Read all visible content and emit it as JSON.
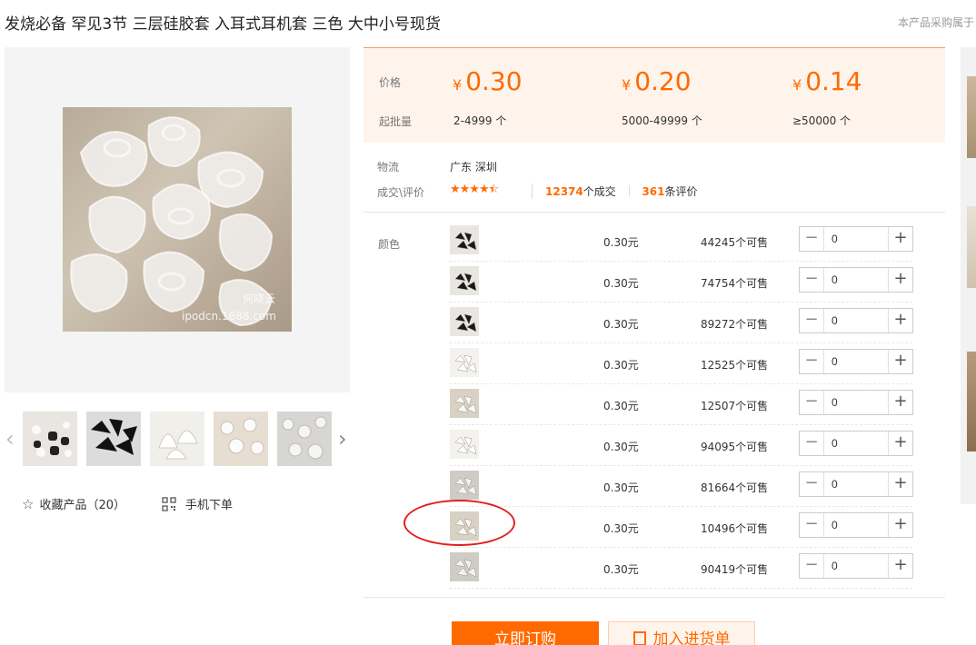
{
  "product": {
    "title": "发烧必备 罕见3节 三层硅胶套 入耳式耳机套 三色 大中小号现货",
    "top_right_note": "本产品采购属于",
    "watermark_line1": "何晓云",
    "watermark_line2": "ipodcn.1688.com"
  },
  "price_panel": {
    "price_label": "价格",
    "moq_label": "起批量",
    "currency": "¥",
    "tiers": [
      {
        "price": "0.30",
        "moq": "2-4999 个"
      },
      {
        "price": "0.20",
        "moq": "5000-49999 个"
      },
      {
        "price": "0.14",
        "moq": "≥50000 个"
      }
    ]
  },
  "info": {
    "logistics_label": "物流",
    "logistics_value": "广东 深圳",
    "reviews_label": "成交\\评价",
    "rating_stars": 4.5,
    "deals_count": "12374",
    "deals_suffix": "个成交",
    "reviews_count": "361",
    "reviews_suffix": "条评价"
  },
  "sku": {
    "color_label": "颜色",
    "rows": [
      {
        "price": "0.30元",
        "stock": "44245个可售",
        "qty": "0",
        "swatch": "black"
      },
      {
        "price": "0.30元",
        "stock": "74754个可售",
        "qty": "0",
        "swatch": "black"
      },
      {
        "price": "0.30元",
        "stock": "89272个可售",
        "qty": "0",
        "swatch": "black"
      },
      {
        "price": "0.30元",
        "stock": "12525个可售",
        "qty": "0",
        "swatch": "clear"
      },
      {
        "price": "0.30元",
        "stock": "12507个可售",
        "qty": "0",
        "swatch": "clear-dark"
      },
      {
        "price": "0.30元",
        "stock": "94095个可售",
        "qty": "0",
        "swatch": "clear"
      },
      {
        "price": "0.30元",
        "stock": "81664个可售",
        "qty": "0",
        "swatch": "white"
      },
      {
        "price": "0.30元",
        "stock": "10496个可售",
        "qty": "0",
        "swatch": "clear-dark"
      },
      {
        "price": "0.30元",
        "stock": "90419个可售",
        "qty": "0",
        "swatch": "white"
      }
    ],
    "minus_symbol": "−",
    "plus_symbol": "+"
  },
  "actions": {
    "favorite_label": "收藏产品（20）",
    "mobile_order_label": "手机下单",
    "buy_now": "立即订购",
    "add_to_cart": "加入进货单"
  },
  "colors": {
    "accent": "#ff6a00",
    "price_panel_bg": "#fef4ec",
    "annotation_circle": "#e02020"
  }
}
